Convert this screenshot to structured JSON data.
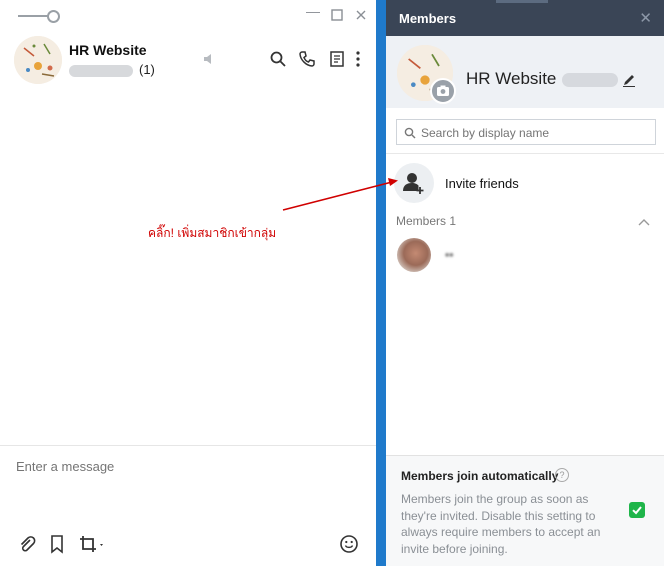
{
  "chat": {
    "title": "HR Website",
    "member_count": "(1)",
    "composer_placeholder": "Enter a message"
  },
  "annotation": {
    "text": "คลิ๊ก! เพิ่มสมาชิกเข้ากลุ่ม",
    "color": "#d00000"
  },
  "members_panel": {
    "title": "Members",
    "group_name": "HR Website",
    "search_placeholder": "Search by display name",
    "invite_label": "Invite friends",
    "members_heading": "Members 1",
    "member_name": "••",
    "auto_join_title": "Members join automatically",
    "auto_join_description": "Members join the group as soon as they're invited. Disable this setting to always require members to accept an invite before joining.",
    "auto_join_enabled": true
  },
  "colors": {
    "header_dark": "#3a4556",
    "accent_blue": "#1f7acb",
    "toggle_green": "#1fb54a"
  }
}
